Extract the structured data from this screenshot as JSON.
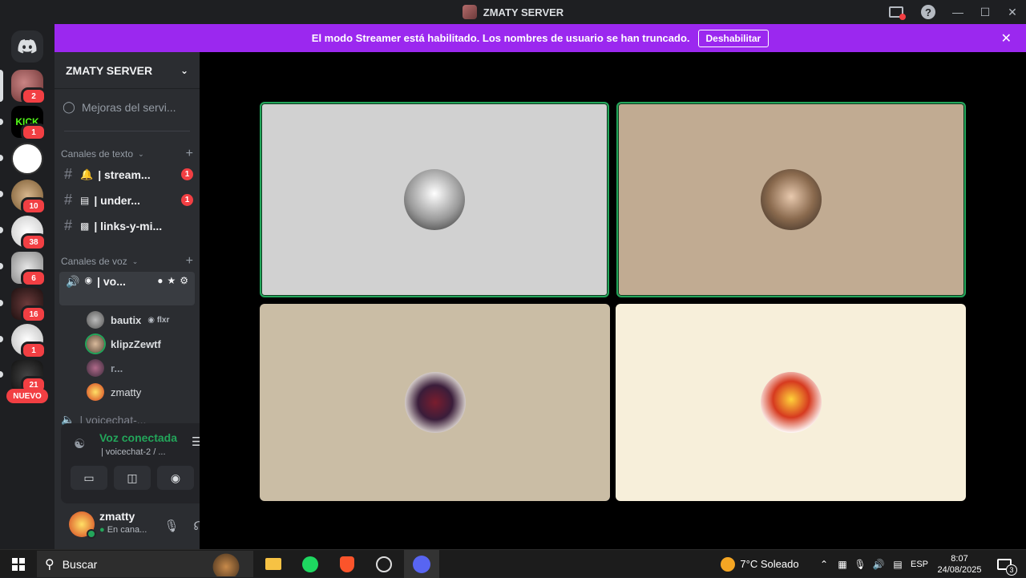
{
  "window": {
    "title": "ZMATY SERVER"
  },
  "banner": {
    "message": "El modo Streamer está habilitado. Los nombres de usuario se han truncado.",
    "button_label": "Deshabilitar"
  },
  "guilds": [
    {
      "badge": "2"
    },
    {
      "badge": "1",
      "label": "KICK"
    },
    {
      "badge": ""
    },
    {
      "badge": "10"
    },
    {
      "badge": "38"
    },
    {
      "badge": "6"
    },
    {
      "badge": "16"
    },
    {
      "badge": "1"
    },
    {
      "badge": "21"
    }
  ],
  "guilds_new_label": "NUEVO",
  "sidebar": {
    "server_name": "ZMATY SERVER",
    "boost_item": "Mejoras del servi...",
    "text_category": "Canales de texto",
    "text_channels": [
      {
        "name": "| stream...",
        "unread": "1"
      },
      {
        "name": "| under...",
        "unread": "1"
      },
      {
        "name": "| links-y-mi..."
      }
    ],
    "voice_category": "Canales de voz",
    "voice_channel": "| vo...",
    "voice_members": [
      {
        "name": "bautix",
        "tag": "flxr"
      },
      {
        "name": "klipzZewtf"
      },
      {
        "name": "r..."
      },
      {
        "name": "zmatty"
      }
    ],
    "next_voice_channel": "| voicechat-..."
  },
  "voice_panel": {
    "title": "Voz conectada",
    "subtitle": "| voicechat-2 / ..."
  },
  "user_panel": {
    "username": "zmatty",
    "status": "En cana..."
  },
  "taskbar": {
    "search_label": "Buscar",
    "weather": "7°C  Soleado",
    "lang": "ESP",
    "time": "8:07",
    "date": "24/08/2025",
    "notif_count": "3"
  },
  "colors": {
    "accent": "#9b28ef",
    "voice_green": "#23a55a",
    "badge_red": "#f23f43"
  }
}
